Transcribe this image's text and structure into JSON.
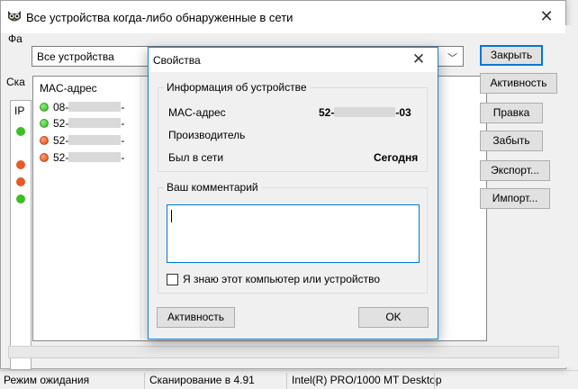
{
  "background": {
    "menu_fragment": "Фа",
    "ska_fragment": "Ска",
    "table_header_fragment": "IP",
    "dot_colors": [
      "green",
      "red",
      "red",
      "green"
    ],
    "status_bar": {
      "state": "Режим ожидания",
      "scan": "Сканирование в 4.91",
      "adapter": "Intel(R) PRO/1000 MT Desktop"
    }
  },
  "devices_window": {
    "title": "Все устройства когда-либо обнаруженные в сети",
    "filter_value": "Все устройства",
    "buttons": {
      "close": "Закрыть",
      "activity": "Активность",
      "edit": "Правка",
      "forget": "Забыть",
      "export": "Экспорт...",
      "import": "Импорт..."
    },
    "list": {
      "column_header": "MAC-адрес",
      "rows": [
        {
          "prefix": "08-",
          "status": "green"
        },
        {
          "prefix": "52-",
          "status": "green"
        },
        {
          "prefix": "52-",
          "status": "red"
        },
        {
          "prefix": "52-",
          "status": "red"
        }
      ],
      "row_suffix": "-"
    }
  },
  "properties_dialog": {
    "title": "Свойства",
    "device_info": {
      "legend": "Информация об устройстве",
      "mac_label": "MAC-адрес",
      "mac_prefix": "52-",
      "mac_suffix": "-03",
      "vendor_label": "Производитель",
      "seen_label": "Был в сети",
      "seen_value": "Сегодня"
    },
    "comment": {
      "legend": "Ваш комментарий",
      "value": "",
      "known_checkbox_label": "Я знаю этот компьютер или устройство",
      "known_checked": false
    },
    "buttons": {
      "activity": "Активность",
      "ok": "OK"
    }
  }
}
